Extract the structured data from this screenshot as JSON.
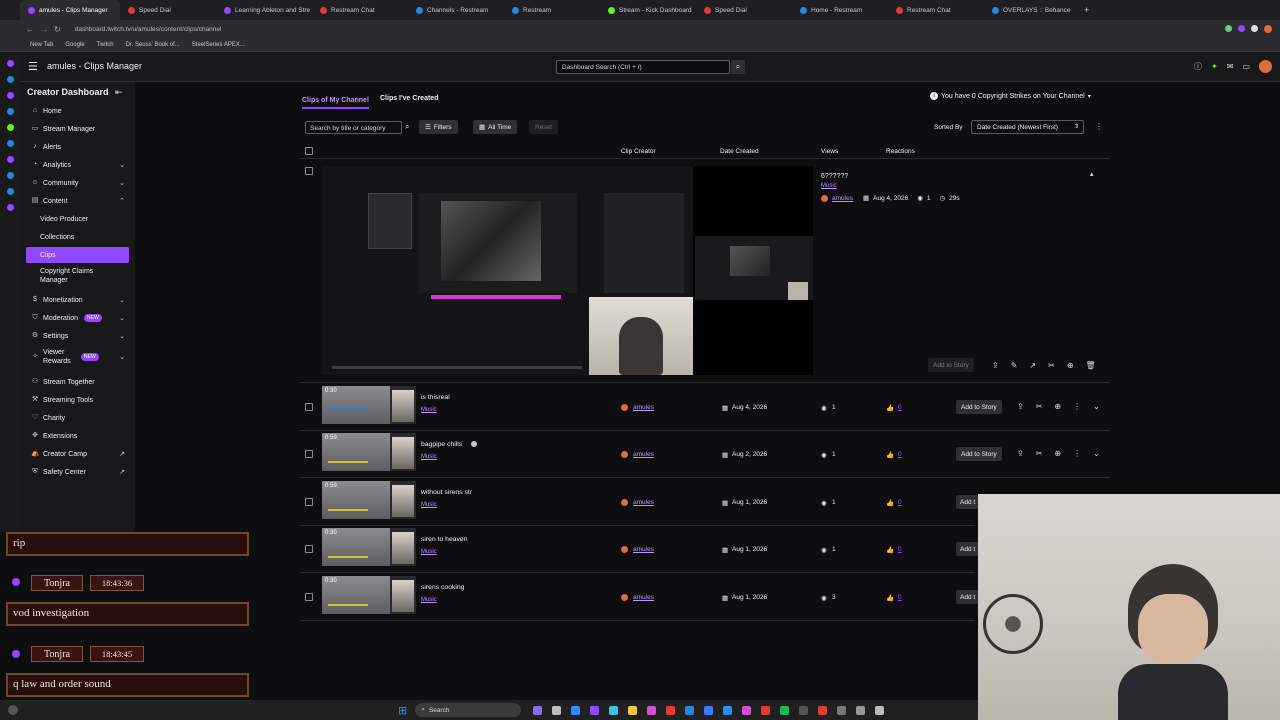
{
  "browser": {
    "tabs": [
      {
        "label": "amules - Clips Manager",
        "color": "#9147ff",
        "active": true
      },
      {
        "label": "Speed Dial",
        "color": "#e53935"
      },
      {
        "label": "Learning Ableton and Stre",
        "color": "#9147ff"
      },
      {
        "label": "Restream Chat",
        "color": "#e53935"
      },
      {
        "label": "Channels - Restream",
        "color": "#1e88e5"
      },
      {
        "label": "Restream",
        "color": "#1e88e5"
      },
      {
        "label": "Stream - Kick Dashboard",
        "color": "#53fc18"
      },
      {
        "label": "Speed Dial",
        "color": "#e53935"
      },
      {
        "label": "Home - Restream",
        "color": "#1e88e5"
      },
      {
        "label": "Restream Chat",
        "color": "#e53935"
      },
      {
        "label": "OVERLAYS :: Behance",
        "color": "#1e88e5"
      }
    ],
    "url": "dashboard.twitch.tv/u/amules/content/clips/channel",
    "bookmarks": [
      "New Tab",
      "Google",
      "Twitch",
      "Dr. Seuss' Book of...",
      "SteelSeries APEX..."
    ]
  },
  "header": {
    "title": "amules - Clips Manager",
    "search_placeholder": "Dashboard Search (Ctrl + /)"
  },
  "sidebar": {
    "title": "Creator Dashboard",
    "items": [
      {
        "label": "Home",
        "icon": "home-icon"
      },
      {
        "label": "Stream Manager",
        "icon": "monitor-icon"
      },
      {
        "label": "Alerts",
        "icon": "bell-icon"
      },
      {
        "label": "Analytics",
        "icon": "chart-icon",
        "chevron": true
      },
      {
        "label": "Community",
        "icon": "people-icon",
        "chevron": true
      },
      {
        "label": "Content",
        "icon": "folder-icon",
        "chevron": true,
        "expanded": true
      },
      {
        "label": "Video Producer",
        "sub": true
      },
      {
        "label": "Collections",
        "sub": true
      },
      {
        "label": "Clips",
        "sub": true,
        "active": true
      },
      {
        "label": "Copyright Claims Manager",
        "sub": true
      },
      {
        "label": "Monetization",
        "icon": "dollar-icon",
        "chevron": true
      },
      {
        "label": "Moderation",
        "icon": "shield-icon",
        "chevron": true,
        "badge": "NEW"
      },
      {
        "label": "Settings",
        "icon": "gear-icon",
        "chevron": true
      },
      {
        "label": "Viewer Rewards",
        "icon": "star-icon",
        "chevron": true,
        "badge": "NEW"
      },
      {
        "label": "Stream Together",
        "icon": "together-icon"
      },
      {
        "label": "Streaming Tools",
        "icon": "tools-icon"
      },
      {
        "label": "Charity",
        "icon": "heart-icon"
      },
      {
        "label": "Extensions",
        "icon": "puzzle-icon"
      },
      {
        "label": "Creator Camp",
        "icon": "camp-icon",
        "external": true
      },
      {
        "label": "Safety Center",
        "icon": "safety-icon",
        "external": true
      }
    ]
  },
  "main": {
    "tabs": [
      "Clips of My Channel",
      "Clips I've Created"
    ],
    "strikes": "You have 0 Copyright Strikes on Your Channel",
    "search_placeholder": "Search by title or category",
    "filters_label": "Filters",
    "time_label": "All Time",
    "reset_label": "Reset",
    "sorted_by_label": "Sorted By",
    "sort_value": "Date Created (Newest First)",
    "columns": {
      "creator": "Clip Creator",
      "date": "Date Created",
      "views": "Views",
      "reactions": "Reactions"
    },
    "expanded_clip": {
      "title": "6??????",
      "category": "Music",
      "creator": "amules",
      "date": "Aug 4, 2026",
      "views": "1",
      "duration": "29s",
      "add_to_story": "Add to Story"
    },
    "rows": [
      {
        "duration": "0:30",
        "title": "is thisreal",
        "category": "Music",
        "creator": "amules",
        "date": "Aug 4, 2026",
        "views": "1",
        "reactions": "0",
        "add": "Add to Story"
      },
      {
        "duration": "0:59",
        "title": "bagpipe chills",
        "category": "Music",
        "creator": "amules",
        "date": "Aug 2, 2026",
        "views": "1",
        "reactions": "0",
        "add": "Add to Story"
      },
      {
        "duration": "0:59",
        "title": "without sirens str",
        "category": "Music",
        "creator": "amules",
        "date": "Aug 1, 2026",
        "views": "1",
        "reactions": "0",
        "add": "Add t"
      },
      {
        "duration": "0:30",
        "title": "siren to heaven",
        "category": "Music",
        "creator": "amules",
        "date": "Aug 1, 2026",
        "views": "1",
        "reactions": "0",
        "add": "Add t"
      },
      {
        "duration": "0:30",
        "title": "sirens cooking",
        "category": "Music",
        "creator": "amules",
        "date": "Aug 1, 2026",
        "views": "3",
        "reactions": "0",
        "add": "Add t"
      }
    ]
  },
  "chat_overlay": {
    "messages": [
      {
        "text": "rip"
      },
      {
        "user": "Tonjra",
        "time": "18:43:36",
        "text": "vod investigation"
      },
      {
        "user": "Tonjra",
        "time": "18:43:45",
        "text": "q law and order sound"
      }
    ]
  },
  "taskbar": {
    "search_placeholder": "Search"
  }
}
